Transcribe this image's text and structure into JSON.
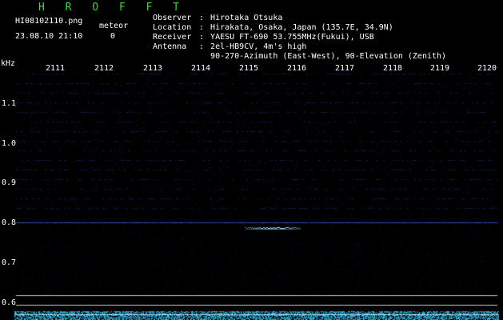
{
  "header": {
    "brand": "H R O F F T",
    "filename": "HI08102110.png",
    "meteor_label": "meteor",
    "timestamp": "23.08.10 21:10",
    "meteor_count": "0"
  },
  "meta": {
    "observer_label": "Observer",
    "observer": "Hirotaka Otsuka",
    "location_label": "Location",
    "location": "Hirakata, Osaka, Japan (135.7E, 34.9N)",
    "receiver_label": "Receiver",
    "receiver": "YAESU FT-690 53.755MHz(Fukui), USB",
    "antenna_label": "Antenna",
    "antenna_line1": "2el-HB9CV, 4m's high",
    "antenna_line2": "90-270-Azimuth (East-West), 90-Elevation (Zenith)",
    "separator": ":"
  },
  "axes": {
    "y_unit": "kHz",
    "x_ticks": [
      "2111",
      "2112",
      "2113",
      "2114",
      "2115",
      "2116",
      "2117",
      "2118",
      "2119",
      "2120"
    ],
    "y_ticks": [
      "1.1",
      "1.0",
      "0.9",
      "0.8",
      "0.7",
      "0.6"
    ]
  },
  "colors": {
    "background": "#000000",
    "brand": "#3ddc3d",
    "noise": "#1a2a8a",
    "signal": "#5fa8ff",
    "echo": "#c8ffff",
    "grid": "#c8c8c8"
  }
}
